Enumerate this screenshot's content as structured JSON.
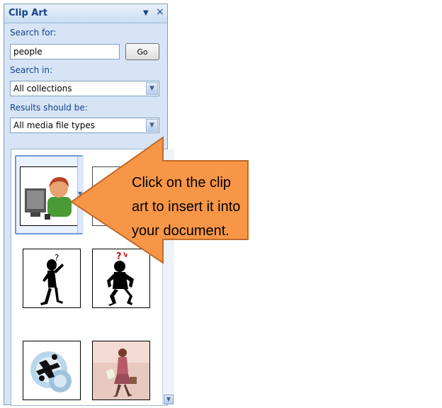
{
  "pane": {
    "title": "Clip Art",
    "dropdown_glyph": "▼",
    "close_glyph": "×",
    "search_label": "Search for:",
    "search_value": "people",
    "go_label": "Go",
    "search_in_label": "Search in:",
    "search_in_value": "All collections",
    "results_label": "Results should be:",
    "results_value": "All media file types"
  },
  "results": {
    "items": [
      {
        "icon": "person-at-computer"
      },
      {
        "icon": "partially-covered-clip"
      },
      {
        "icon": "confused-stick-figure"
      },
      {
        "icon": "stressed-stick-figure"
      },
      {
        "icon": "people-in-gears"
      },
      {
        "icon": "woman-walking"
      }
    ]
  },
  "callout": {
    "text": "Click on the clip art to insert it into your document.",
    "color": "#f79646"
  }
}
